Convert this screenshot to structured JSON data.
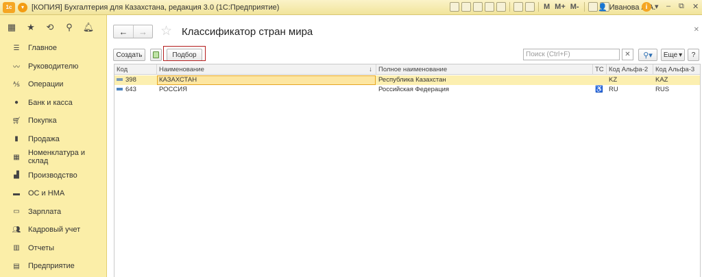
{
  "titlebar": {
    "logo": "1с",
    "title": "[КОПИЯ] Бухгалтерия для Казахстана, редакция 3.0  (1С:Предприятие)",
    "m": "M",
    "m_plus": "M+",
    "m_minus": "M-",
    "user": "Иванова А.А.",
    "info": "i"
  },
  "sidebar": {
    "items": [
      {
        "label": "Главное",
        "icon": "menu-lines-icon"
      },
      {
        "label": "Руководителю",
        "icon": "chart-line-icon"
      },
      {
        "label": "Операции",
        "icon": "operations-icon"
      },
      {
        "label": "Банк и касса",
        "icon": "coin-icon"
      },
      {
        "label": "Покупка",
        "icon": "cart-icon"
      },
      {
        "label": "Продажа",
        "icon": "bag-icon"
      },
      {
        "label": "Номенклатура и склад",
        "icon": "grid-icon"
      },
      {
        "label": "Производство",
        "icon": "factory-icon"
      },
      {
        "label": "ОС и НМА",
        "icon": "truck-icon"
      },
      {
        "label": "Зарплата",
        "icon": "wallet-icon"
      },
      {
        "label": "Кадровый учет",
        "icon": "people-icon"
      },
      {
        "label": "Отчеты",
        "icon": "bar-chart-icon"
      },
      {
        "label": "Предприятие",
        "icon": "building-icon"
      }
    ]
  },
  "form": {
    "title": "Классификатор стран мира",
    "create_label": "Создать",
    "pick_label": "Подбор",
    "search_placeholder": "Поиск (Ctrl+F)",
    "more_label": "Еще",
    "help_label": "?"
  },
  "table": {
    "columns": [
      "Код",
      "Наименование",
      "Полное наименование",
      "ТС",
      "Код Альфа-2",
      "Код Альфа-3"
    ],
    "rows": [
      {
        "code": "398",
        "name": "КАЗАХСТАН",
        "full_name": "Республика Казахстан",
        "ts": "",
        "alpha2": "KZ",
        "alpha3": "KAZ"
      },
      {
        "code": "643",
        "name": "РОССИЯ",
        "full_name": "Российская Федерация",
        "ts": "♿",
        "alpha2": "RU",
        "alpha3": "RUS"
      }
    ]
  },
  "colors": {
    "sidebar_bg": "#fbeea8",
    "titlebar_bg": "#f1e49b",
    "selected_row": "#fcefb0",
    "highlight_box": "#b31b1b"
  }
}
